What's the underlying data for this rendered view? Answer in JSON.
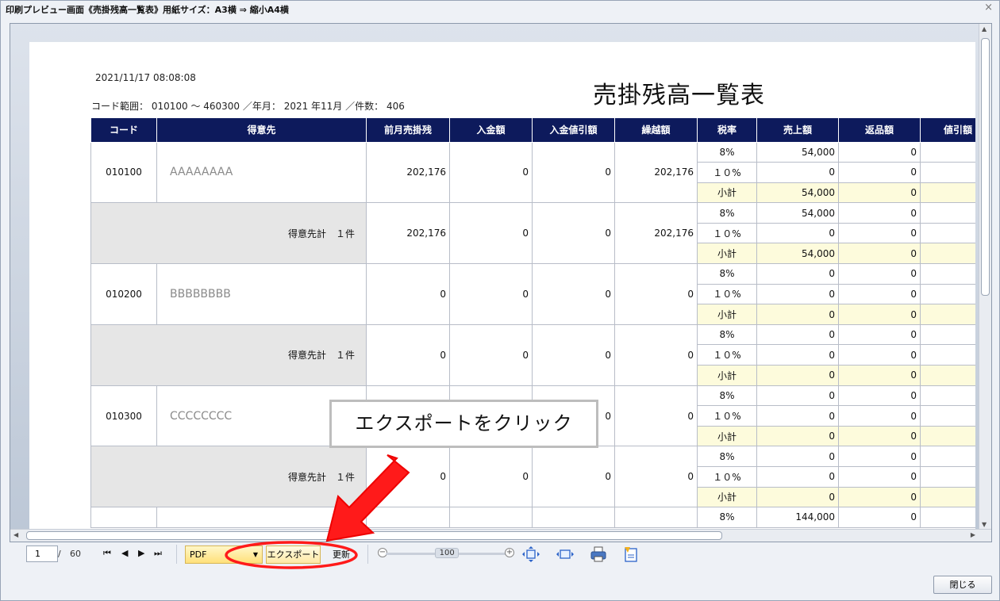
{
  "window": {
    "title": "印刷プレビュー画面《売掛残高一覧表》用紙サイズ：A3横 ⇒ 縮小A4横",
    "close_glyph": "×"
  },
  "report": {
    "print_date": "2021/11/17 08:08:08",
    "title": "売掛残高一覧表",
    "conditions": "コード範囲： 010100 ～ 460300 ／年月： 2021 年11月 ／件数： 406",
    "columns": [
      "コード",
      "得意先",
      "前月売掛残",
      "入金額",
      "入金値引額",
      "繰越額",
      "税率",
      "売上額",
      "返品額",
      "値引額"
    ],
    "blocks": [
      {
        "kind": "customer",
        "code": "010100",
        "name": "AAAAAAAA",
        "prev": "202,176",
        "receipt": "0",
        "discount": "0",
        "carry": "202,176",
        "rows": [
          {
            "tax": "8%",
            "sales": "54,000",
            "returns": "0"
          },
          {
            "tax": "１０%",
            "sales": "0",
            "returns": "0"
          },
          {
            "tax": "小計",
            "sales": "54,000",
            "returns": "0"
          }
        ]
      },
      {
        "kind": "total",
        "label": "得意先計　１件",
        "prev": "202,176",
        "receipt": "0",
        "discount": "0",
        "carry": "202,176",
        "rows": [
          {
            "tax": "8%",
            "sales": "54,000",
            "returns": "0"
          },
          {
            "tax": "１０%",
            "sales": "0",
            "returns": "0"
          },
          {
            "tax": "小計",
            "sales": "54,000",
            "returns": "0"
          }
        ]
      },
      {
        "kind": "customer",
        "code": "010200",
        "name": "BBBBBBBB",
        "prev": "0",
        "receipt": "0",
        "discount": "0",
        "carry": "0",
        "rows": [
          {
            "tax": "8%",
            "sales": "0",
            "returns": "0"
          },
          {
            "tax": "１０%",
            "sales": "0",
            "returns": "0"
          },
          {
            "tax": "小計",
            "sales": "0",
            "returns": "0"
          }
        ]
      },
      {
        "kind": "total",
        "label": "得意先計　１件",
        "prev": "0",
        "receipt": "0",
        "discount": "0",
        "carry": "0",
        "rows": [
          {
            "tax": "8%",
            "sales": "0",
            "returns": "0"
          },
          {
            "tax": "１０%",
            "sales": "0",
            "returns": "0"
          },
          {
            "tax": "小計",
            "sales": "0",
            "returns": "0"
          }
        ]
      },
      {
        "kind": "customer",
        "code": "010300",
        "name": "CCCCCCCC",
        "prev": "",
        "receipt": "",
        "discount": "0",
        "carry": "0",
        "rows": [
          {
            "tax": "8%",
            "sales": "0",
            "returns": "0"
          },
          {
            "tax": "１０%",
            "sales": "0",
            "returns": "0"
          },
          {
            "tax": "小計",
            "sales": "0",
            "returns": "0"
          }
        ]
      },
      {
        "kind": "total",
        "label": "得意先計　１件",
        "prev": "0",
        "receipt": "0",
        "discount": "0",
        "carry": "0",
        "rows": [
          {
            "tax": "8%",
            "sales": "0",
            "returns": "0"
          },
          {
            "tax": "１０%",
            "sales": "0",
            "returns": "0"
          },
          {
            "tax": "小計",
            "sales": "0",
            "returns": "0"
          }
        ]
      },
      {
        "kind": "partial",
        "rows": [
          {
            "tax": "8%",
            "sales": "144,000",
            "returns": "0"
          }
        ]
      }
    ]
  },
  "toolbar": {
    "current_page": "1",
    "page_separator": "/",
    "total_pages": "60",
    "nav_first": "⏮",
    "nav_prev": "◀",
    "nav_next": "▶",
    "nav_last": "⏭",
    "format": "PDF",
    "export_label": "エクスポート",
    "refresh_label": "更新",
    "zoom": "100",
    "zoom_fraction": 0.45,
    "zoom_minus": "−",
    "zoom_plus": "+"
  },
  "footer": {
    "close_label": "閉じる"
  },
  "callout": {
    "text": "エクスポートをクリック"
  },
  "colors": {
    "header_bg": "#0d1a5c",
    "subtotal_bg": "#fdfbdc",
    "total_bg": "#e6e6e6",
    "arrow": "#ff0000"
  }
}
